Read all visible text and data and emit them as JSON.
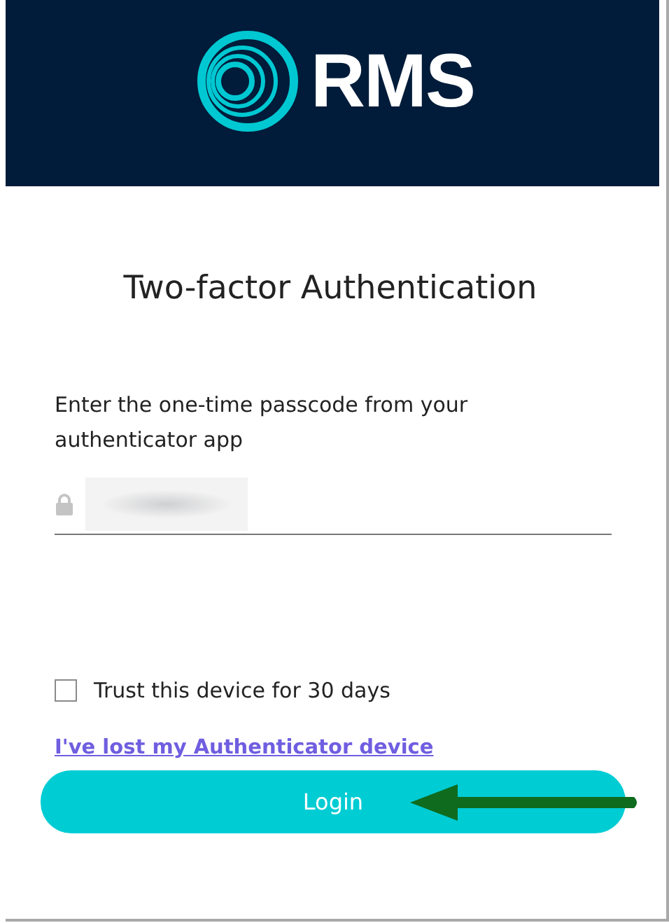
{
  "header": {
    "logo_text": "RMS"
  },
  "title": "Two-factor Authentication",
  "prompt": "Enter the one-time passcode from your authenticator app",
  "passcode_field": {
    "redacted": true
  },
  "trust_device": {
    "label": "Trust this device for 30 days",
    "checked": false
  },
  "lost_device_link": "I've lost my Authenticator device",
  "login_button": "Login"
}
